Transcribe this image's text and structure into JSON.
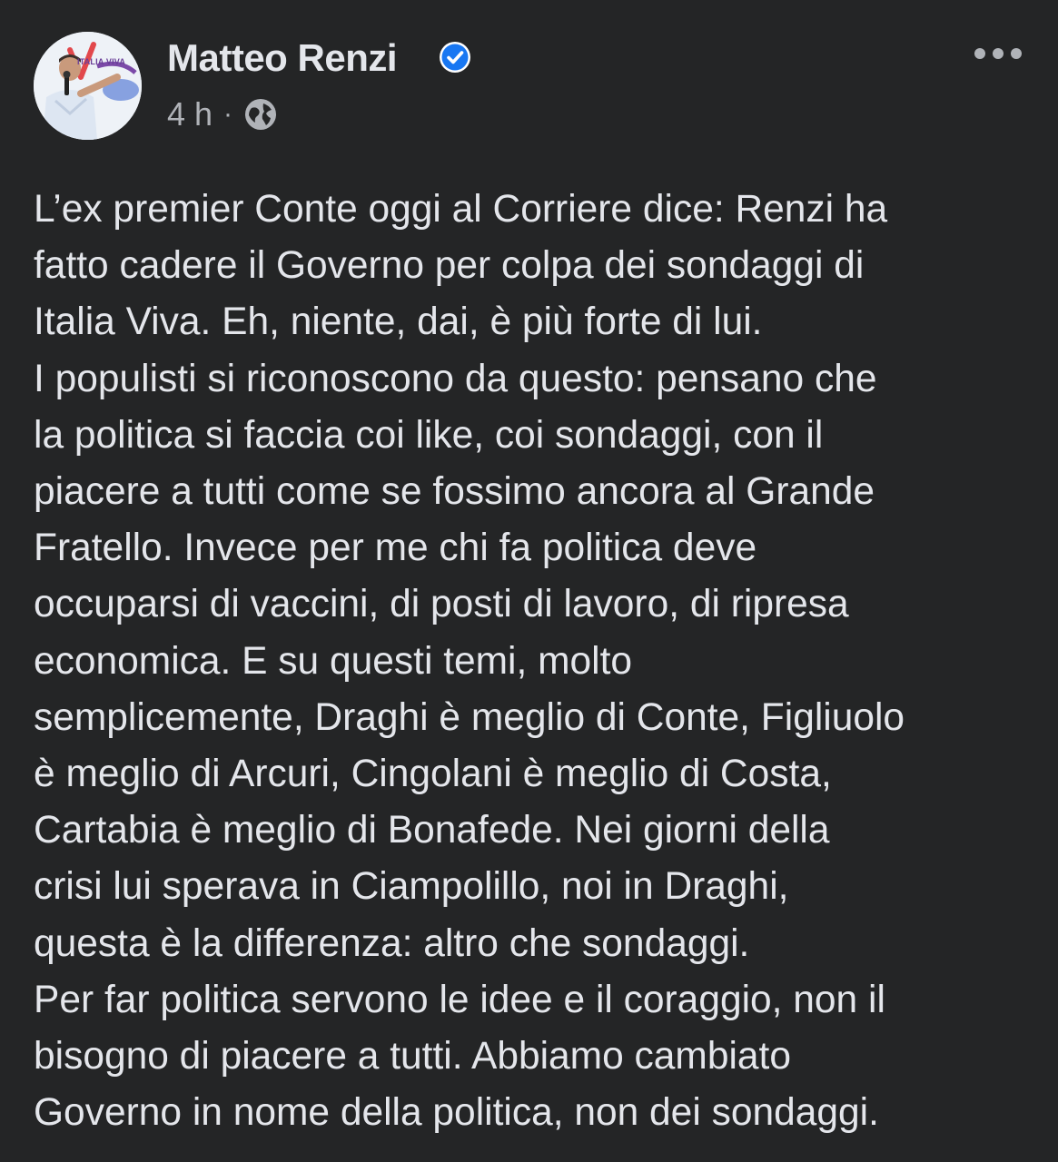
{
  "post": {
    "author": {
      "name": "Matteo Renzi",
      "avatar_logo_text": "ITALIA VIVA",
      "verified_icon": "verified-badge-icon"
    },
    "timestamp": "4 h",
    "separator": "·",
    "audience_icon": "globe-icon",
    "menu_icon": "more-horizontal-icon",
    "text_lines": [
      "L’ex premier Conte oggi al Corriere dice: Renzi ha",
      "fatto cadere il Governo per colpa dei sondaggi di",
      "Italia Viva. Eh, niente, dai, è più forte di lui.",
      "I populisti si riconoscono da questo: pensano che",
      "la politica si faccia coi like, coi sondaggi, con il",
      "piacere a tutti come se fossimo ancora al Grande",
      "Fratello. Invece per me chi fa politica deve",
      "occuparsi di vaccini, di posti di lavoro, di ripresa",
      "economica. E su questi temi, molto",
      "semplicemente, Draghi è meglio di Conte, Figliuolo",
      "è meglio di Arcuri, Cingolani è meglio di Costa,",
      "Cartabia è meglio di Bonafede. Nei giorni della",
      "crisi lui sperava in Ciampolillo, noi in Draghi,",
      "questa è la differenza: altro che sondaggi.",
      "Per far politica servono le idee e il coraggio, non il",
      "bisogno di piacere a tutti. Abbiamo cambiato",
      "Governo in nome della politica, non dei sondaggi."
    ],
    "colors": {
      "background": "#242526",
      "primary_text": "#e4e6eb",
      "secondary_text": "#b0b3b8",
      "verified_blue": "#1877f2"
    }
  }
}
